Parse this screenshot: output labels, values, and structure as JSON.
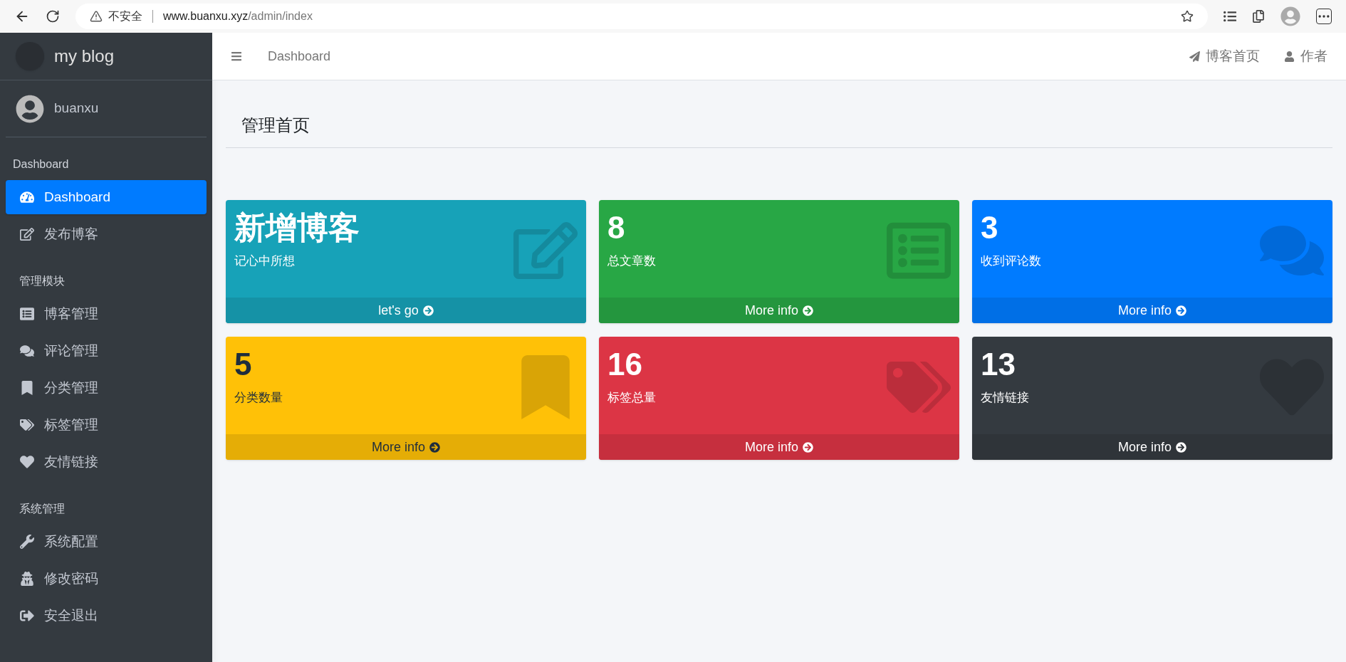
{
  "browser": {
    "security": "不安全",
    "host": "www.buanxu.xyz",
    "path": "/admin/index"
  },
  "sidebar": {
    "brand": "my blog",
    "user": "buanxu",
    "sections": [
      {
        "title": "Dashboard",
        "items": [
          {
            "label": "Dashboard",
            "selected": true
          },
          {
            "label": "发布博客",
            "selected": false
          }
        ]
      },
      {
        "title": "管理模块",
        "items": [
          {
            "label": "博客管理",
            "selected": false
          },
          {
            "label": "评论管理",
            "selected": false
          },
          {
            "label": "分类管理",
            "selected": false
          },
          {
            "label": "标签管理",
            "selected": false
          },
          {
            "label": "友情链接",
            "selected": false
          }
        ]
      },
      {
        "title": "系统管理",
        "items": [
          {
            "label": "系统配置",
            "selected": false
          },
          {
            "label": "修改密码",
            "selected": false
          },
          {
            "label": "安全退出",
            "selected": false
          }
        ]
      }
    ]
  },
  "navbar": {
    "breadcrumb": "Dashboard",
    "links": [
      "博客首页",
      "作者"
    ]
  },
  "page_title": "管理首页",
  "cards": [
    {
      "kind": "info",
      "value": "新增博客",
      "label": "记心中所想",
      "footer": "let's go"
    },
    {
      "kind": "success",
      "value": "8",
      "label": "总文章数",
      "footer": "More info"
    },
    {
      "kind": "primary",
      "value": "3",
      "label": "收到评论数",
      "footer": "More info"
    },
    {
      "kind": "warning",
      "value": "5",
      "label": "分类数量",
      "footer": "More info"
    },
    {
      "kind": "danger",
      "value": "16",
      "label": "标签总量",
      "footer": "More info"
    },
    {
      "kind": "dark",
      "value": "13",
      "label": "友情链接",
      "footer": "More info"
    }
  ]
}
